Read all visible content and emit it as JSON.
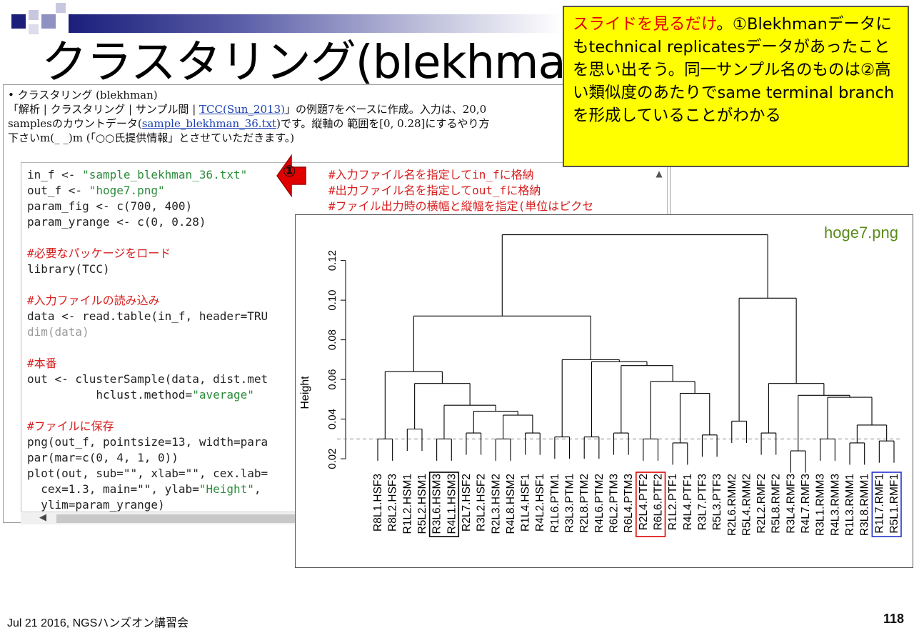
{
  "slide": {
    "title": "クラスタリング(blekhman)",
    "footer_left": "Jul 21 2016, NGSハンズオン講習会",
    "page_number": "118"
  },
  "callout": {
    "red_text": "スライドを見るだけ",
    "body_text": "。①Blekhmanデータにもtechnical replicatesデータがあったことを思い出そう。同一サンプル名のものは②高い類似度のあたりでsame terminal branchを形成していることがわかる"
  },
  "doc": {
    "bullet": "• クラスタリング (blekhman)",
    "line2_pre": "「解析 | クラスタリング | サンプル間 | ",
    "line2_link": "TCC(Sun_2013)",
    "line2_post": "」の例題7をベースに作成。入力は、20,0",
    "line3_pre": "samplesのカウントデータ(",
    "line3_link": "sample_blekhman_36.txt",
    "line3_post": ")です。縦軸の 範囲を[0, 0.28]にするやり方",
    "line4": "下さいm(_ _)m (「○○氏提供情報」とさせていただきます。)"
  },
  "code": {
    "lines": [
      "in_f <- \"sample_blekhman_36.txt\"",
      "out_f <- \"hoge7.png\"",
      "param_fig <- c(700, 400)",
      "param_yrange <- c(0, 0.28)",
      "",
      "#必要なパッケージをロード",
      "library(TCC)",
      "",
      "#入力ファイルの読み込み",
      "data <- read.table(in_f, header=TRU",
      "dim(data)",
      "",
      "#本番",
      "out <- clusterSample(data, dist.met",
      "          hclust.method=\"average\"",
      "",
      "#ファイルに保存",
      "png(out_f, pointsize=13, width=para",
      "par(mar=c(0, 4, 1, 0))",
      "plot(out, sub=\"\", xlab=\"\", cex.lab=",
      "  cex=1.3, main=\"\", ylab=\"Height\",",
      "  ylim=param_yrange)"
    ],
    "comments": [
      "#入力ファイル名を指定してin_fに格納",
      "#出力ファイル名を指定してout_fに格納",
      "#ファイル出力時の横幅と縦幅を指定(単位はピクセ"
    ]
  },
  "markers": {
    "one": "①",
    "two": "②"
  },
  "plot": {
    "caption": "hoge7.png"
  },
  "chart_data": {
    "type": "dendrogram",
    "title": "",
    "xlabel": "",
    "ylabel": "Height",
    "ylim": [
      0.015,
      0.135
    ],
    "yticks": [
      0.02,
      0.04,
      0.06,
      0.08,
      0.1,
      0.12
    ],
    "cut_line": 0.03,
    "leaves": [
      "R8L1.HSF3",
      "R8L2.HSF3",
      "R1L2.HSM1",
      "R5L2.HSM1",
      "R3L6.HSM3",
      "R4L1.HSM3",
      "R2L7.HSF2",
      "R3L2.HSF2",
      "R2L3.HSM2",
      "R4L8.HSM2",
      "R1L4.HSF1",
      "R4L2.HSF1",
      "R1L6.PTM1",
      "R3L3.PTM1",
      "R2L8.PTM2",
      "R4L6.PTM2",
      "R6L2.PTM3",
      "R6L4.PTM3",
      "R2L4.PTF2",
      "R6L6.PTF2",
      "R1L2.PTF1",
      "R4L4.PTF1",
      "R3L7.PTF3",
      "R5L3.PTF3",
      "R2L6.RMM2",
      "R5L4.RMM2",
      "R2L2.RMF2",
      "R5L8.RMF2",
      "R3L4.RMF3",
      "R4L7.RMF3",
      "R3L1.RMM3",
      "R4L3.RMM3",
      "R1L3.RMM1",
      "R3L8.RMM1",
      "R1L7.RMF1",
      "R5L1.RMF1"
    ],
    "merges": [
      [
        -1,
        -2,
        0.03
      ],
      [
        -3,
        -4,
        0.035
      ],
      [
        -5,
        -6,
        0.03
      ],
      [
        -7,
        -8,
        0.033
      ],
      [
        -9,
        -10,
        0.03
      ],
      [
        -11,
        -12,
        0.033
      ],
      [
        -13,
        -14,
        0.031
      ],
      [
        -15,
        -16,
        0.031
      ],
      [
        -17,
        -18,
        0.033
      ],
      [
        -19,
        -20,
        0.03
      ],
      [
        -21,
        -22,
        0.028
      ],
      [
        -23,
        -24,
        0.032
      ],
      [
        -25,
        -26,
        0.039
      ],
      [
        -27,
        -28,
        0.033
      ],
      [
        -29,
        -30,
        0.024
      ],
      [
        -31,
        -32,
        0.03
      ],
      [
        -33,
        -34,
        0.028
      ],
      [
        -35,
        -36,
        0.029
      ],
      [
        5,
        6,
        0.042
      ],
      [
        4,
        19,
        0.044
      ],
      [
        3,
        20,
        0.047
      ],
      [
        2,
        21,
        0.058
      ],
      [
        1,
        22,
        0.064
      ],
      [
        11,
        12,
        0.053
      ],
      [
        10,
        24,
        0.059
      ],
      [
        9,
        25,
        0.067
      ],
      [
        8,
        26,
        0.069
      ],
      [
        7,
        27,
        0.07
      ],
      [
        17,
        18,
        0.037
      ],
      [
        16,
        29,
        0.051
      ],
      [
        15,
        30,
        0.052
      ],
      [
        14,
        31,
        0.058
      ],
      [
        13,
        32,
        0.101
      ],
      [
        23,
        28,
        0.092
      ],
      [
        33,
        34,
        0.133
      ]
    ],
    "highlight_boxes": [
      {
        "leaves": [
          "R3L6.HSM3",
          "R4L1.HSM3"
        ],
        "color": "#000000"
      },
      {
        "leaves": [
          "R2L4.PTF2",
          "R6L6.PTF2"
        ],
        "color": "#e00000"
      },
      {
        "leaves": [
          "R1L7.RMF1",
          "R5L1.RMF1"
        ],
        "color": "#2233cc"
      }
    ]
  }
}
